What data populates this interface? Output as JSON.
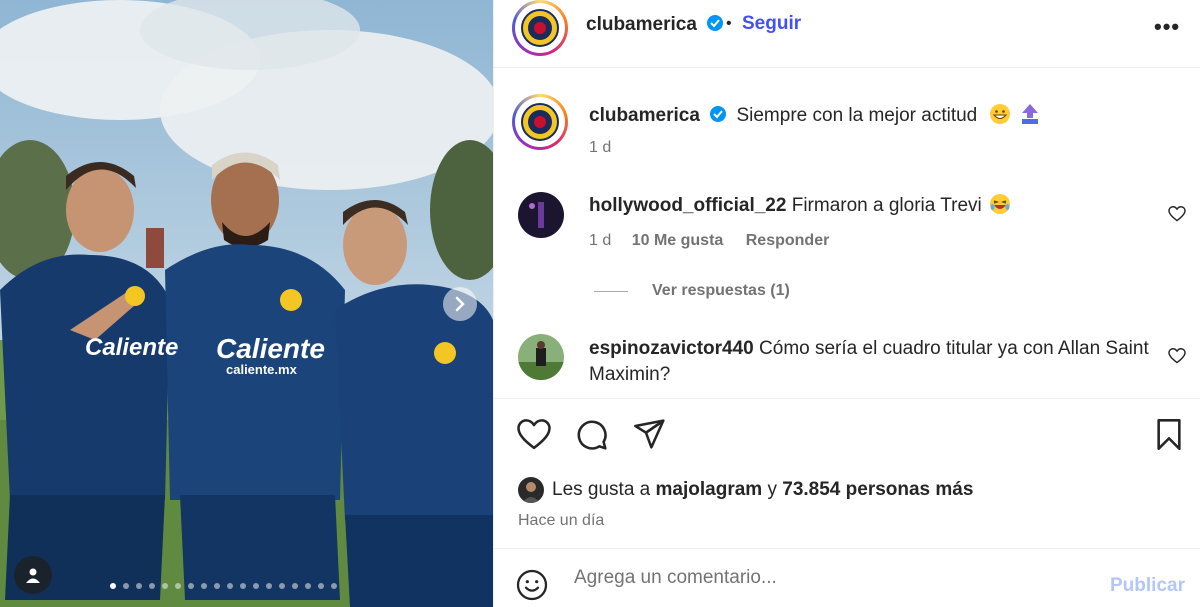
{
  "post": {
    "username": "clubamerica",
    "follow_label": "Seguir",
    "separator": "•",
    "more_label": "•••",
    "caption_text": "Siempre con la mejor actitud",
    "caption_time": "1 d",
    "caption_emojis": [
      "grinning-face-emoji",
      "top-arrow-emoji"
    ],
    "carousel": {
      "slide_count": 18,
      "active_index": 0
    }
  },
  "comments": [
    {
      "username": "hollywood_official_22",
      "text": "Firmaron a gloria Trevi",
      "emoji": "laughing-emoji",
      "time": "1 d",
      "likes": "10 Me gusta",
      "reply_label": "Responder"
    },
    {
      "username": "espinozavictor440",
      "text": "Cómo sería el cuadro titular ya con Allan Saint Maximin?"
    }
  ],
  "view_replies": "Ver respuestas (1)",
  "likes_summary": {
    "prefix": "Les gusta a",
    "user": "majolagram",
    "joiner": "y",
    "others": "73.854 personas más"
  },
  "posted_ago": "Hace un día",
  "comment_box": {
    "placeholder": "Agrega un comentario...",
    "publish_label": "Publicar"
  },
  "colors": {
    "accent": "#4150f7",
    "publish_disabled": "#b2c7f7",
    "secondary_text": "#737373",
    "verified": "#0095f6"
  }
}
